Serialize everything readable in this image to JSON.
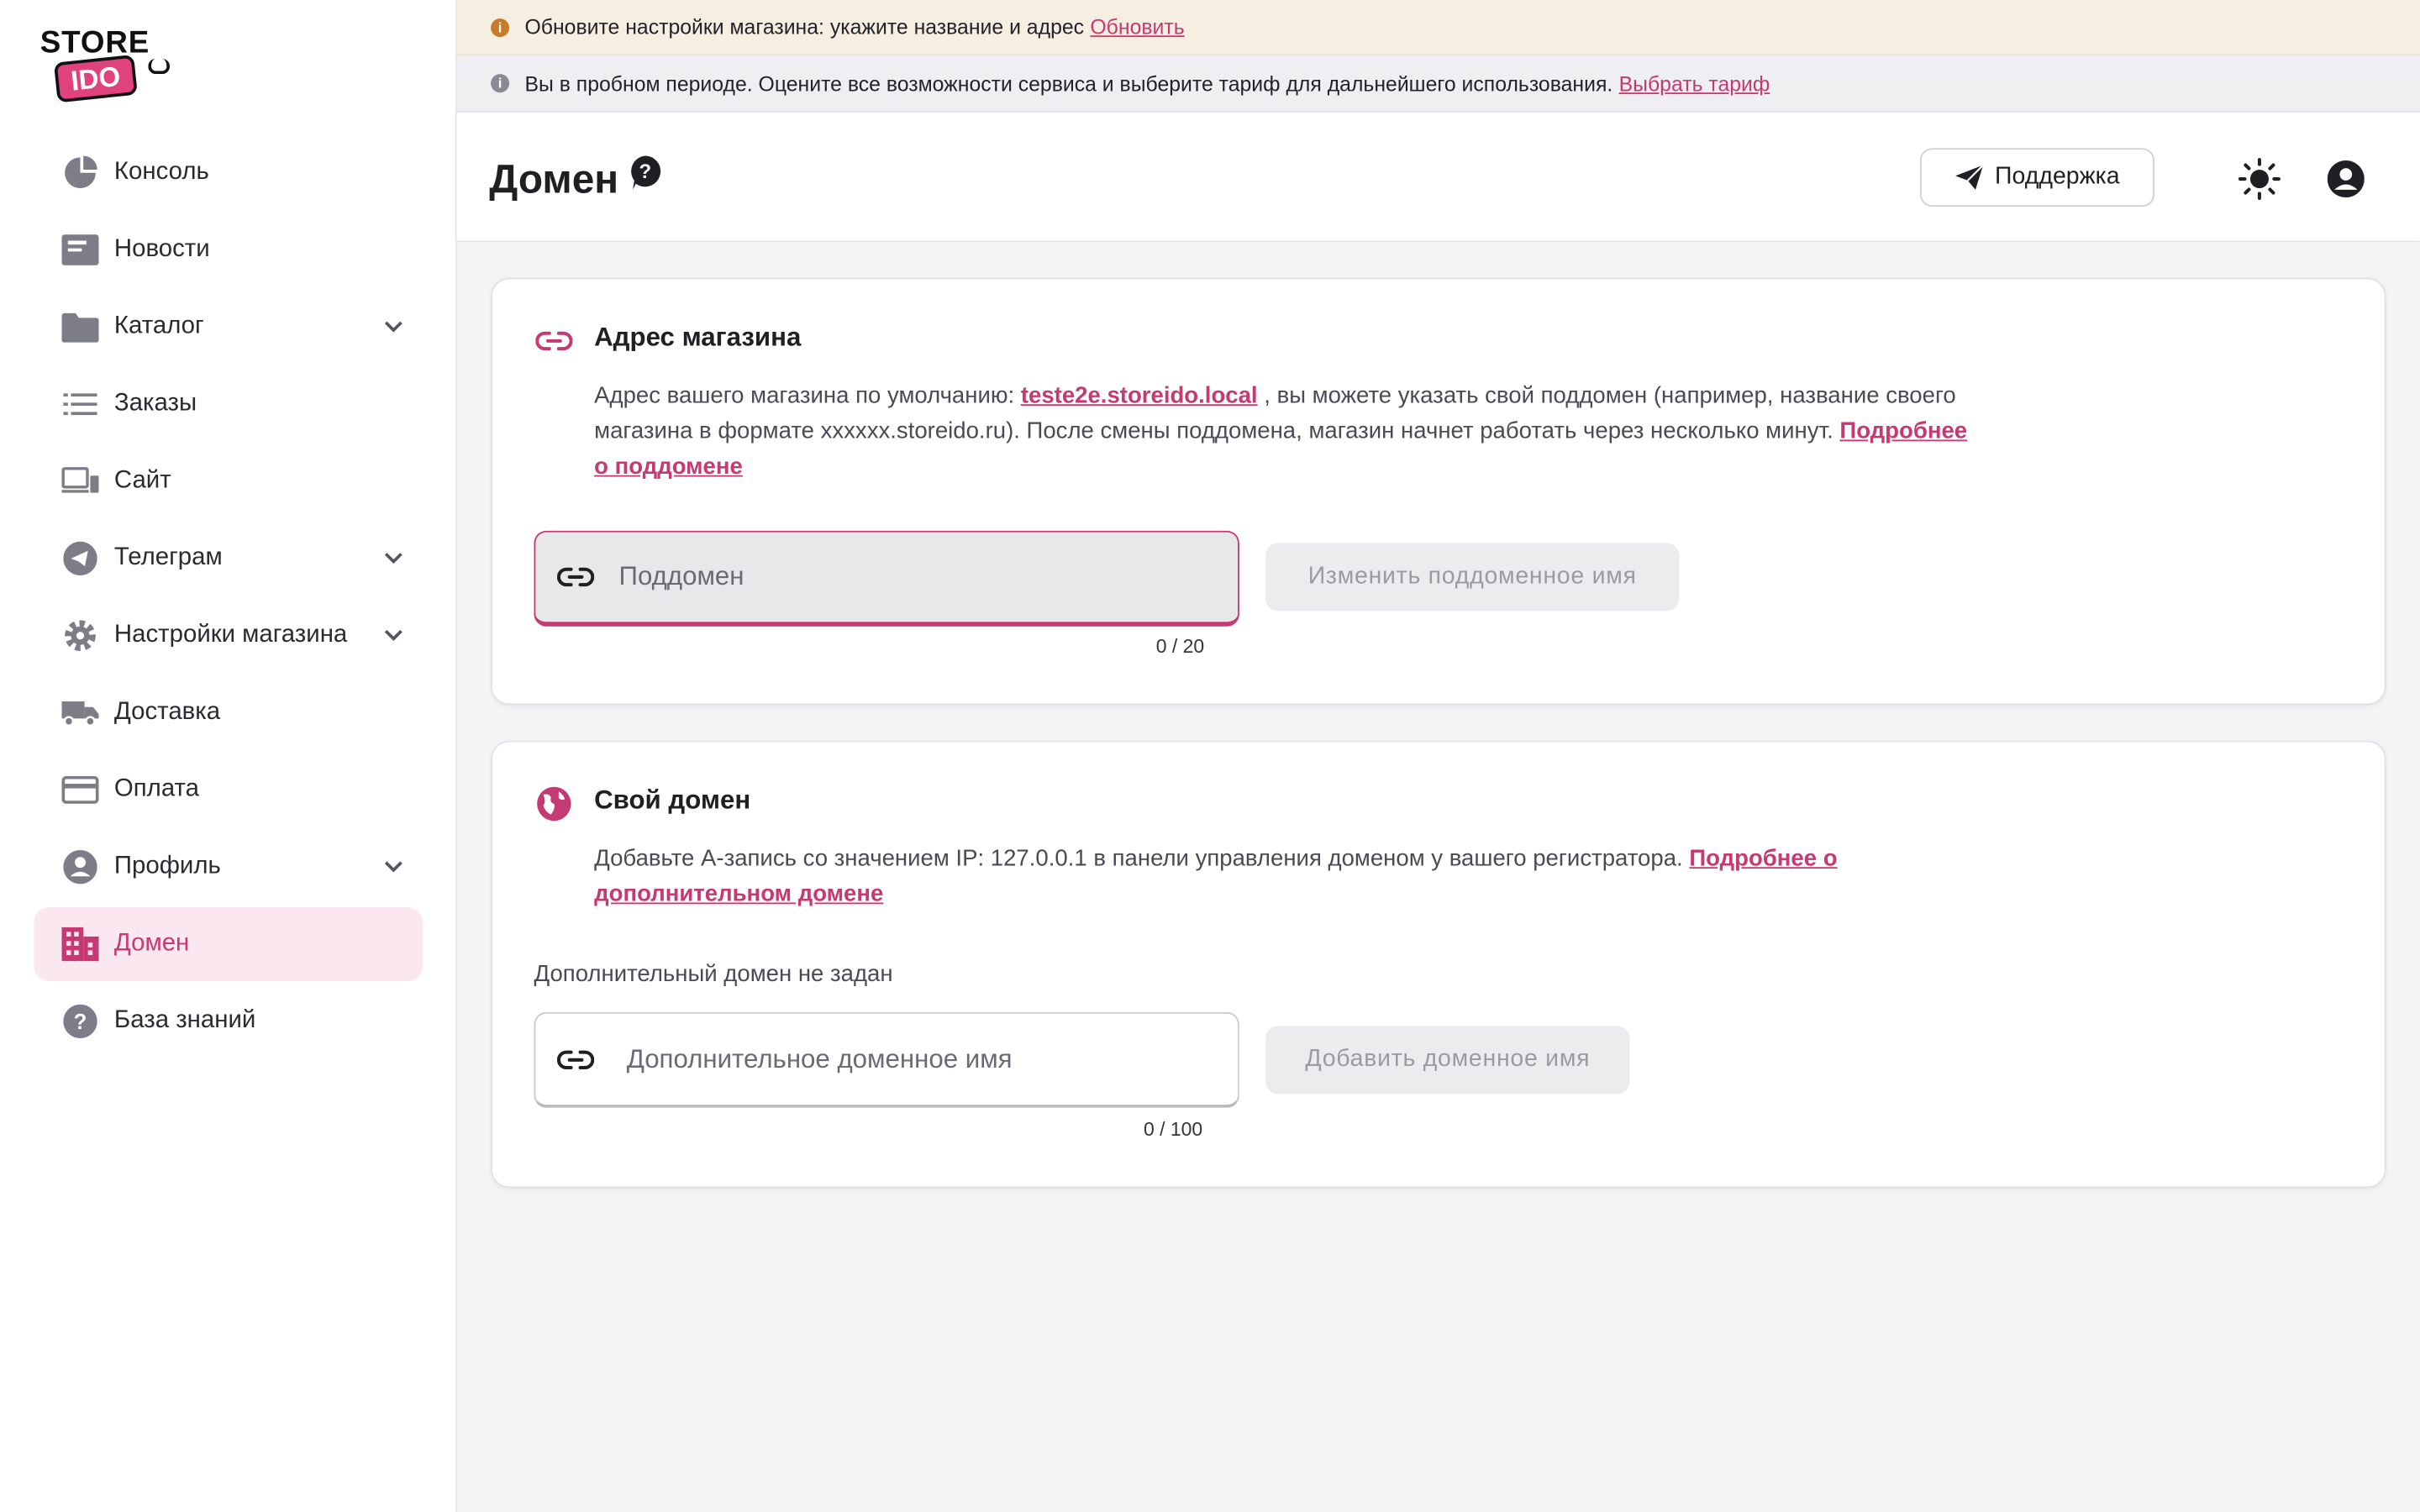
{
  "logo": {
    "line1": "STORE",
    "line2": "IDO"
  },
  "sidebar": {
    "items": [
      {
        "label": "Консоль",
        "icon": "chart-pie-icon",
        "has_chevron": false
      },
      {
        "label": "Новости",
        "icon": "newspaper-icon",
        "has_chevron": false
      },
      {
        "label": "Каталог",
        "icon": "folder-icon",
        "has_chevron": true
      },
      {
        "label": "Заказы",
        "icon": "list-icon",
        "has_chevron": false
      },
      {
        "label": "Сайт",
        "icon": "devices-icon",
        "has_chevron": false
      },
      {
        "label": "Телеграм",
        "icon": "telegram-icon",
        "has_chevron": true
      },
      {
        "label": "Настройки магазина",
        "icon": "gear-icon",
        "has_chevron": true
      },
      {
        "label": "Доставка",
        "icon": "truck-icon",
        "has_chevron": false
      },
      {
        "label": "Оплата",
        "icon": "credit-card-icon",
        "has_chevron": false
      },
      {
        "label": "Профиль",
        "icon": "user-circle-icon",
        "has_chevron": true
      },
      {
        "label": "Домен",
        "icon": "building-icon",
        "has_chevron": false,
        "active": true
      },
      {
        "label": "База знаний",
        "icon": "help-circle-icon",
        "has_chevron": false
      }
    ]
  },
  "banners": {
    "settings": {
      "text": "Обновите настройки магазина: укажите название и адрес",
      "link": "Обновить",
      "icon": "info-icon",
      "color": "#c97b2a"
    },
    "trial": {
      "text": "Вы в пробном периоде. Оцените все возможности сервиса и выберите тариф для дальнейшего использования.",
      "link": "Выбрать тариф",
      "icon": "info-icon",
      "color": "#8a8a94"
    }
  },
  "header": {
    "title": "Домен",
    "support_label": "Поддержка"
  },
  "store_address": {
    "title": "Адрес магазина",
    "desc_prefix": "Адрес вашего магазина по умолчанию:",
    "default_domain": "teste2e.storeido.local",
    "desc_suffix": ", вы можете указать свой поддомен (например, название своего магазина в формате xxxxxx.storeido.ru). После смены поддомена, магазин начнет работать через несколько минут.",
    "more_link": "Подробнее о поддомене",
    "input_placeholder": "Поддомен",
    "input_value": "",
    "counter": "0 / 20",
    "button_label": "Изменить поддоменное имя"
  },
  "custom_domain": {
    "title": "Свой домен",
    "desc": "Добавьте А-запись со значением IP: 127.0.0.1 в панели управления доменом у вашего регистратора.",
    "more_link": "Подробнее о дополнительном домене",
    "status": "Дополнительный домен не задан",
    "input_placeholder": "Дополнительное доменное имя",
    "input_value": "",
    "counter": "0 / 100",
    "button_label": "Добавить доменное имя"
  },
  "colors": {
    "accent": "#c63a74",
    "active_bg": "#fbe7ef",
    "banner_warning_bg": "#f7eee2",
    "banner_info_bg": "#efeff2"
  }
}
